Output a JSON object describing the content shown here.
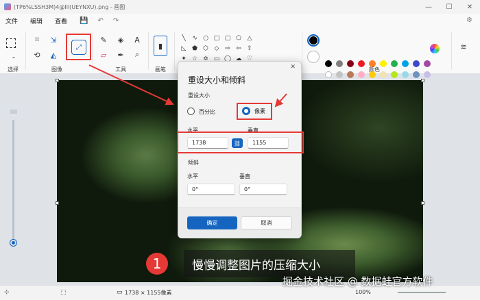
{
  "window": {
    "title": "(TP6%LSSH3M)4@Ill(UEYNXU).png - 画图",
    "minimize": "—",
    "maximize": "☐",
    "close": "✕"
  },
  "menu": {
    "file": "文件",
    "edit": "编辑",
    "view": "查看",
    "save_icon": "save-icon",
    "undo_icon": "undo-icon",
    "redo_icon": "redo-icon"
  },
  "ribbon": {
    "groups": {
      "select": "选择",
      "image": "图像",
      "tools": "工具",
      "brushes": "画笔",
      "colors": "颜色"
    },
    "tools": {
      "text": "A"
    },
    "palette_row1": [
      "#000000",
      "#7f7f7f",
      "#880015",
      "#ed1c24",
      "#ff7f27",
      "#fff200",
      "#22b14c",
      "#00a2e8",
      "#3f48cc",
      "#a349a4"
    ],
    "palette_row2": [
      "#ffffff",
      "#c3c3c3",
      "#b97a57",
      "#ffaec9",
      "#ffc90e",
      "#efe4b0",
      "#b5e61d",
      "#99d9ea",
      "#7092be",
      "#c8bfe7"
    ],
    "current_color": "#000000"
  },
  "dialog": {
    "title": "重设大小和倾斜",
    "resize_section": "重设大小",
    "percent_label": "百分比",
    "pixels_label": "像素",
    "horizontal_label": "水平",
    "vertical_label": "垂直",
    "width_value": "1738",
    "height_value": "1155",
    "skew_section": "倾斜",
    "skew_h_label": "水平",
    "skew_v_label": "垂直",
    "skew_h_value": "0°",
    "skew_v_value": "0°",
    "ok": "确定",
    "cancel": "取消",
    "close": "✕"
  },
  "overlay": {
    "step_number": "1",
    "caption": "慢慢调整图片的压缩大小",
    "watermark": "掘金技术社区 @ 数据蛙官方软件"
  },
  "status": {
    "dimensions": "1738 × 1155像素",
    "zoom": "100%"
  },
  "colors": {
    "accent": "#1565c0",
    "highlight": "#e53935"
  }
}
